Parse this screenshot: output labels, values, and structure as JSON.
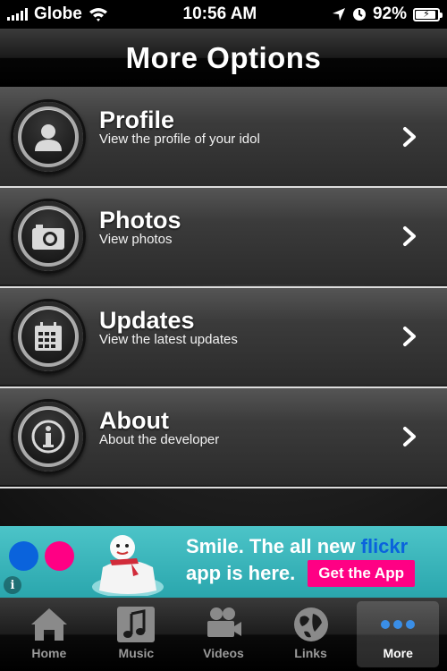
{
  "status_bar": {
    "carrier": "Globe",
    "time": "10:56 AM",
    "battery_percent": "92%"
  },
  "nav": {
    "title": "More Options"
  },
  "menu": {
    "items": [
      {
        "title": "Profile",
        "subtitle": "View the profile of your idol",
        "icon": "person-icon"
      },
      {
        "title": "Photos",
        "subtitle": "View photos",
        "icon": "camera-icon"
      },
      {
        "title": "Updates",
        "subtitle": "View the latest updates",
        "icon": "calendar-icon"
      },
      {
        "title": "About",
        "subtitle": "About the developer",
        "icon": "info-icon"
      }
    ]
  },
  "ad": {
    "line1": "Smile. The all new ",
    "brand": "flickr",
    "line2": "app is here.",
    "button": "Get the App",
    "info": "i",
    "colors": {
      "blue": "#0a63dc",
      "pink": "#ff0084",
      "background": "#3bb8bd"
    }
  },
  "tab_bar": {
    "tabs": [
      {
        "label": "Home",
        "icon": "home-icon"
      },
      {
        "label": "Music",
        "icon": "music-icon"
      },
      {
        "label": "Videos",
        "icon": "video-camera-icon"
      },
      {
        "label": "Links",
        "icon": "globe-icon"
      },
      {
        "label": "More",
        "icon": "more-dots-icon",
        "active": true
      }
    ]
  }
}
